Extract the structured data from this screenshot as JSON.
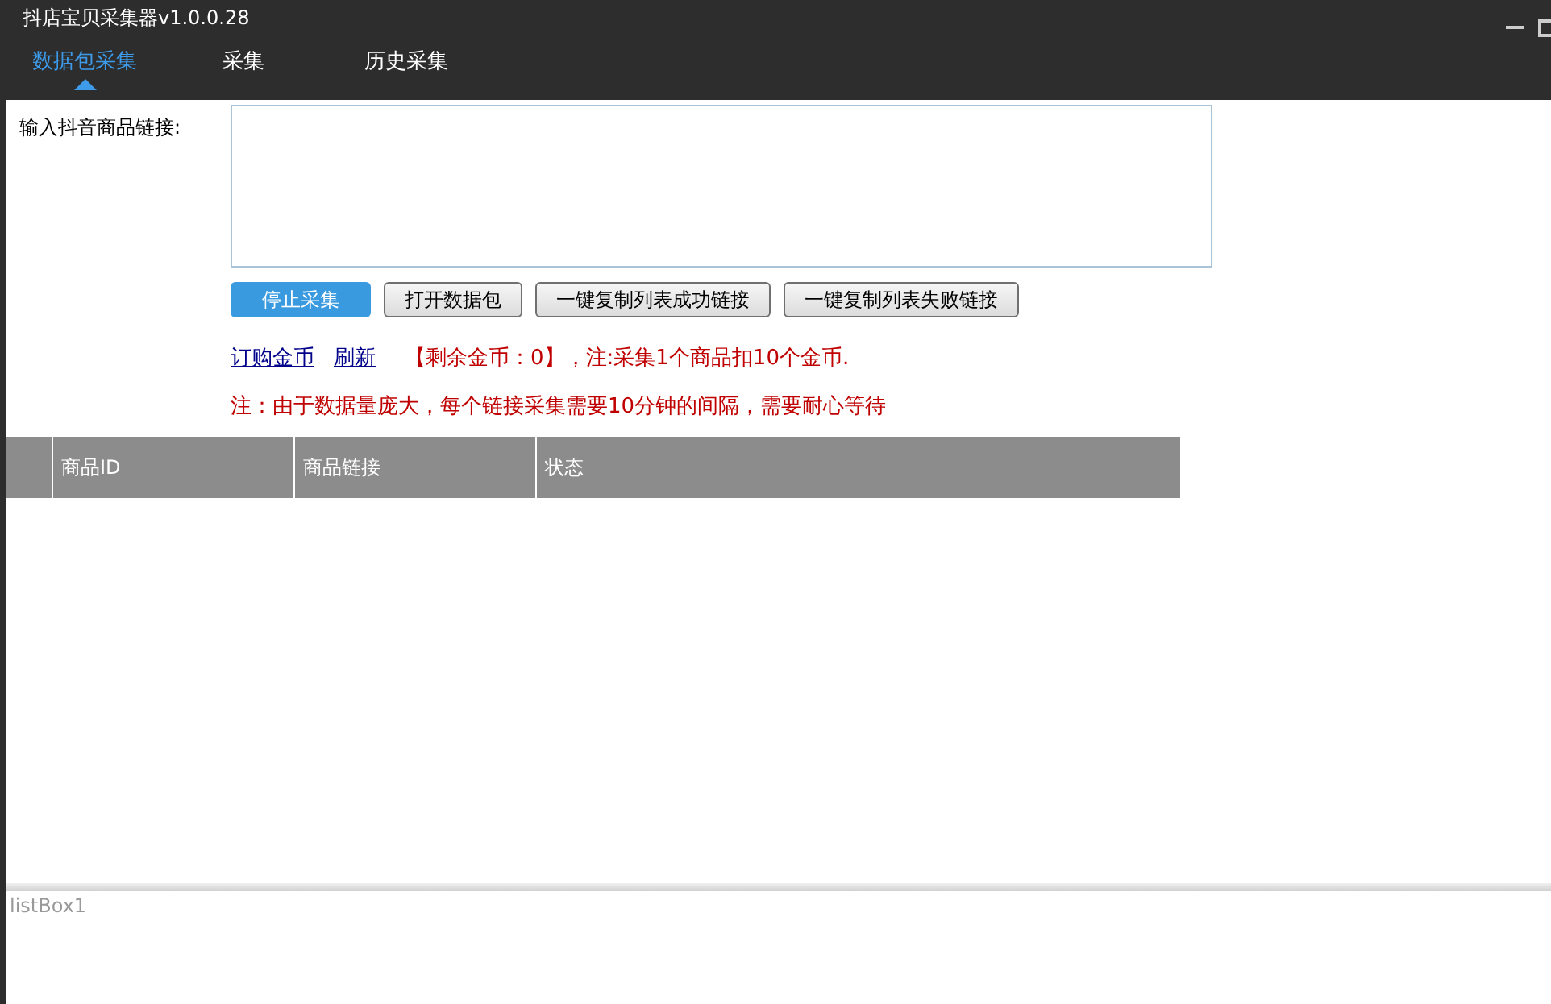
{
  "window": {
    "title": "抖店宝贝采集器v1.0.0.28"
  },
  "tabs": [
    {
      "label": "数据包采集",
      "selected": true
    },
    {
      "label": "采集",
      "selected": false
    },
    {
      "label": "历史采集",
      "selected": false
    }
  ],
  "link_input": {
    "label": "输入抖音商品链接:"
  },
  "buttons": [
    {
      "label": "停止采集",
      "kind": "primary"
    },
    {
      "label": "打开数据包",
      "kind": "default"
    },
    {
      "label": "一键复制列表成功链接",
      "kind": "default"
    },
    {
      "label": "一键复制列表失败链接",
      "kind": "default"
    }
  ],
  "links": [
    "订购金币",
    "刷新"
  ],
  "coin_notice": "【剩余金币：0】，注:采集1个商品扣10个金币.",
  "note": "注：由于数据量庞大，每个链接采集需要10分钟的间隔，需要耐心等待",
  "table": {
    "columns": [
      "商品ID",
      "商品链接",
      "状态"
    ]
  },
  "log_box": {
    "placeholder": "listBox1"
  }
}
